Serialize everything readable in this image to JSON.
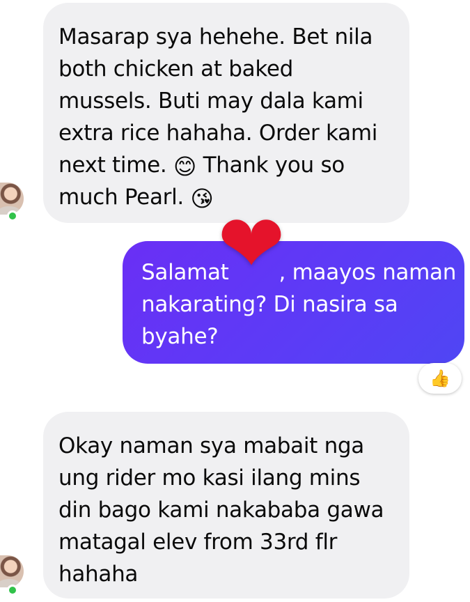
{
  "messages": [
    {
      "direction": "incoming",
      "lines": [
        "Masarap sya hehehe. Bet nila",
        "both chicken at baked",
        "mussels. Buti may dala kami",
        "extra rice hahaha. Order kami",
        "next time.",
        "Thank you so",
        "much Pearl."
      ],
      "emojis": [
        "😊",
        "😘"
      ]
    },
    {
      "direction": "outgoing",
      "lines": [
        "Salamat",
        ", maayos naman",
        "nakarating? Di nasira sa",
        "byahe?"
      ],
      "reaction_overlay": "❤",
      "reaction_badge": "👍"
    },
    {
      "direction": "incoming",
      "lines": [
        "Okay naman sya mabait nga",
        "ung rider mo kasi ilang mins",
        "din bago kami nakababa gawa",
        "matagal elev from 33rd flr",
        "hahaha"
      ]
    }
  ],
  "colors": {
    "incoming_bubble": "#f0f0f2",
    "outgoing_bubble_start": "#6a2ff5",
    "outgoing_bubble_end": "#4f46f4",
    "online_dot": "#31c24a",
    "heart": "#e5132b"
  },
  "icons": {
    "avatar": "contact-avatar",
    "online": "online-status-dot",
    "heart": "heart-reaction-icon",
    "thumbs_up": "thumbs-up-icon"
  }
}
